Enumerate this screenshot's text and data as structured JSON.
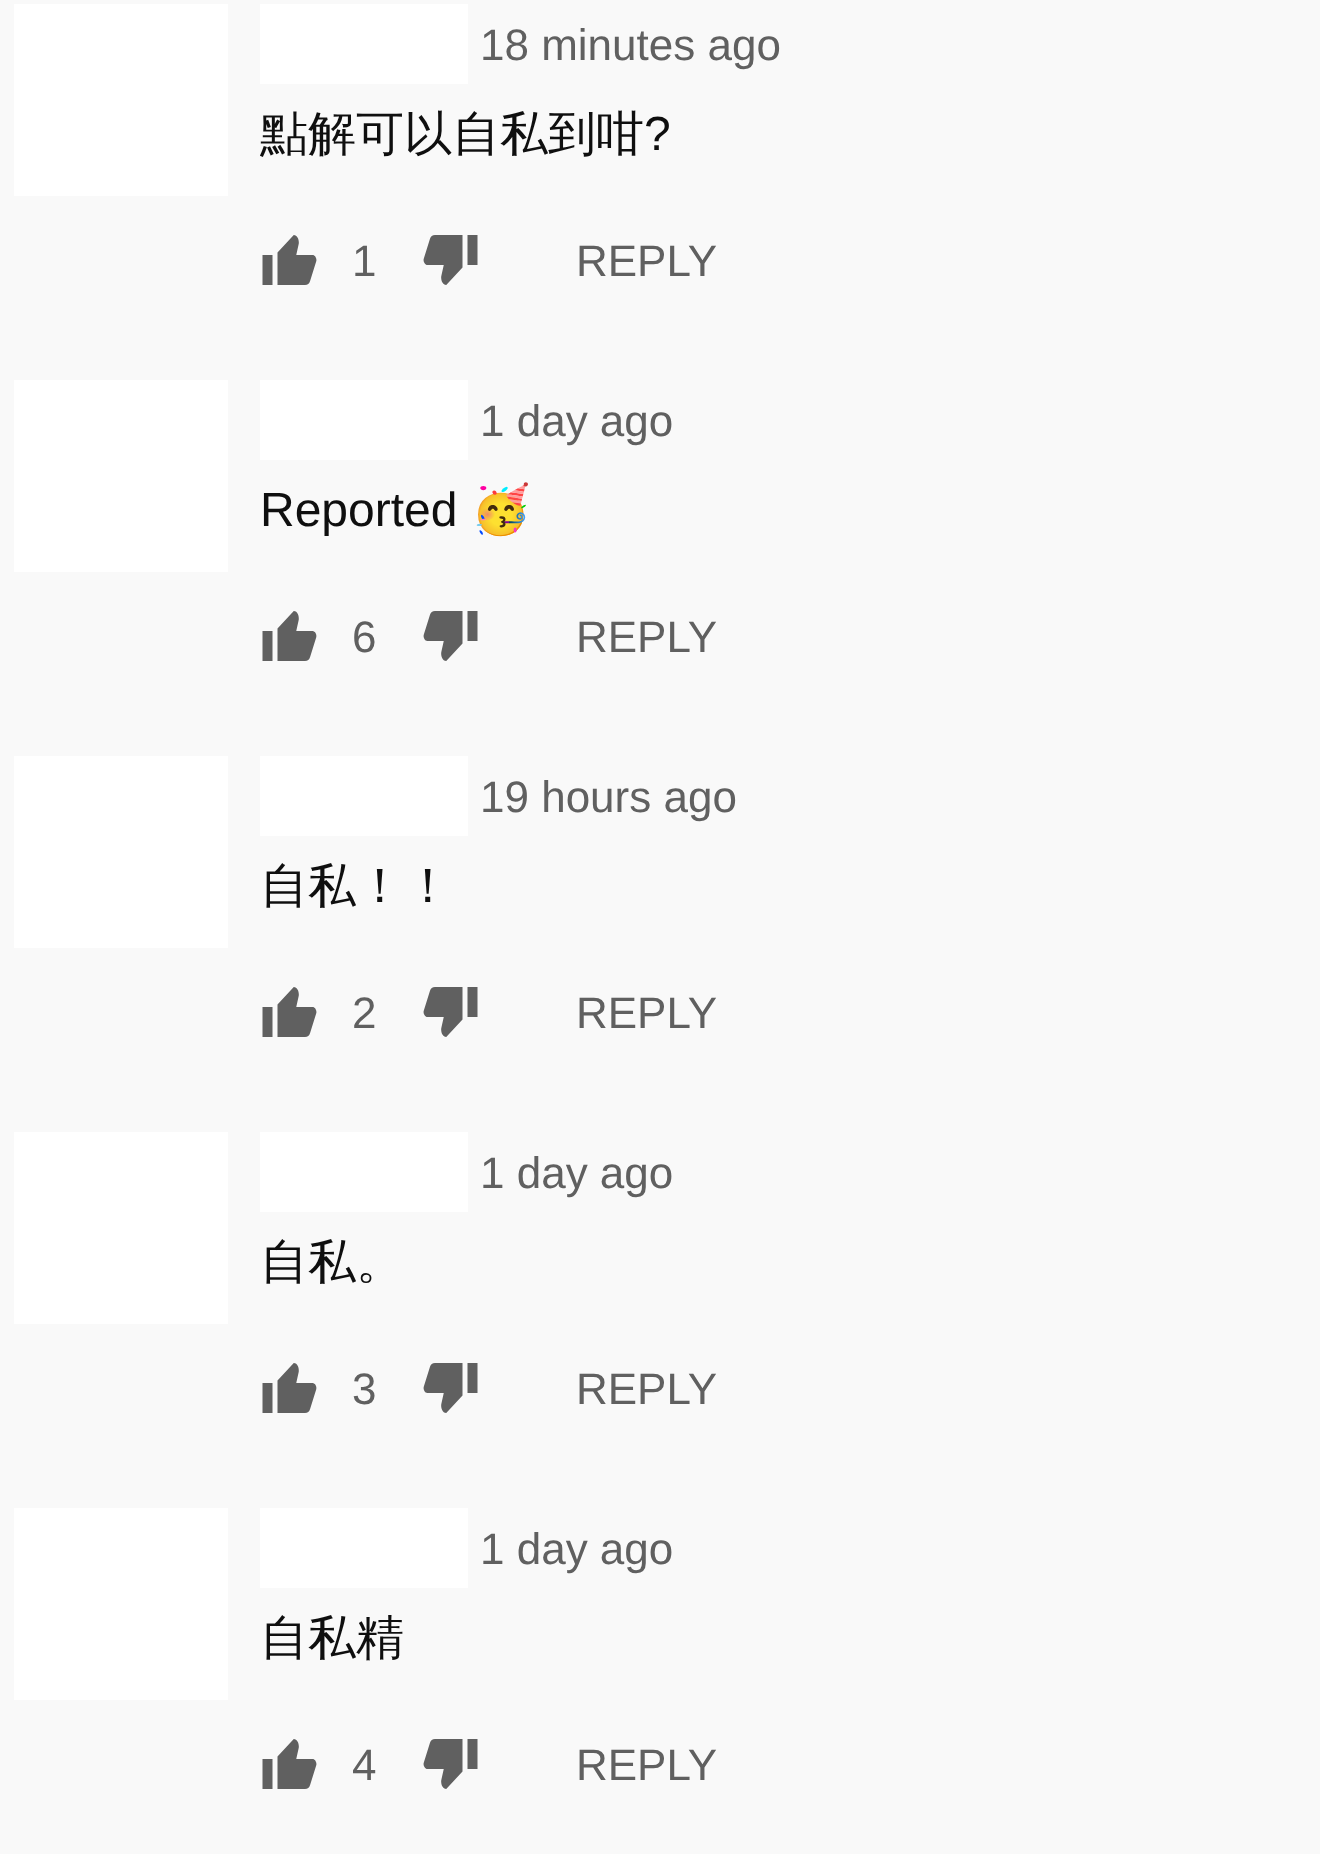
{
  "comments": [
    {
      "time": "18 minutes ago",
      "text": "點解可以自私到咁?",
      "likes": "1",
      "reply": "REPLY"
    },
    {
      "time": "1 day ago",
      "text": "Reported 🥳",
      "likes": "6",
      "reply": "REPLY"
    },
    {
      "time": "19 hours ago",
      "text": "自私！！",
      "likes": "2",
      "reply": "REPLY"
    },
    {
      "time": "1 day ago",
      "text": "自私。",
      "likes": "3",
      "reply": "REPLY"
    },
    {
      "time": "1 day ago",
      "text": "自私精",
      "likes": "4",
      "reply": "REPLY"
    }
  ]
}
